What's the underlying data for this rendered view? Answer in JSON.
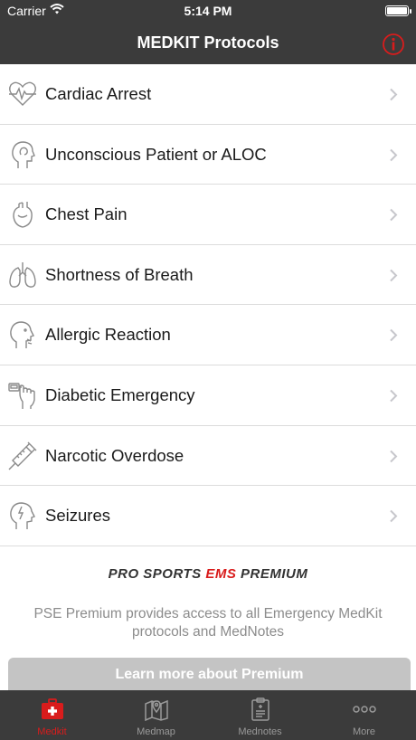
{
  "status_bar": {
    "carrier": "Carrier",
    "time": "5:14 PM"
  },
  "nav": {
    "title": "MEDKIT Protocols",
    "info_icon": "info-icon"
  },
  "protocols": [
    {
      "label": "Cardiac Arrest",
      "icon": "heartbeat-icon"
    },
    {
      "label": "Unconscious Patient or ALOC",
      "icon": "head-profile-icon"
    },
    {
      "label": "Chest Pain",
      "icon": "heart-icon"
    },
    {
      "label": "Shortness of Breath",
      "icon": "lungs-icon"
    },
    {
      "label": "Allergic Reaction",
      "icon": "face-allergy-icon"
    },
    {
      "label": "Diabetic Emergency",
      "icon": "glucose-meter-icon"
    },
    {
      "label": "Narcotic Overdose",
      "icon": "syringe-icon"
    },
    {
      "label": "Seizures",
      "icon": "brain-head-icon"
    }
  ],
  "premium": {
    "brand_prefix": "PRO SPORTS ",
    "brand_accent": "EMS",
    "brand_suffix": " PREMIUM",
    "description": "PSE Premium provides access to all Emergency MedKit protocols and MedNotes",
    "button_label": "Learn more about Premium"
  },
  "tabs": [
    {
      "label": "Medkit",
      "icon": "medkit-icon",
      "active": true
    },
    {
      "label": "Medmap",
      "icon": "map-pin-icon",
      "active": false
    },
    {
      "label": "Mednotes",
      "icon": "clipboard-icon",
      "active": false
    },
    {
      "label": "More",
      "icon": "more-dots-icon",
      "active": false
    }
  ],
  "colors": {
    "bar": "#3b3b3b",
    "accent": "#d91c1c",
    "divider": "#dcdcdc",
    "button": "#c4c4c4"
  }
}
